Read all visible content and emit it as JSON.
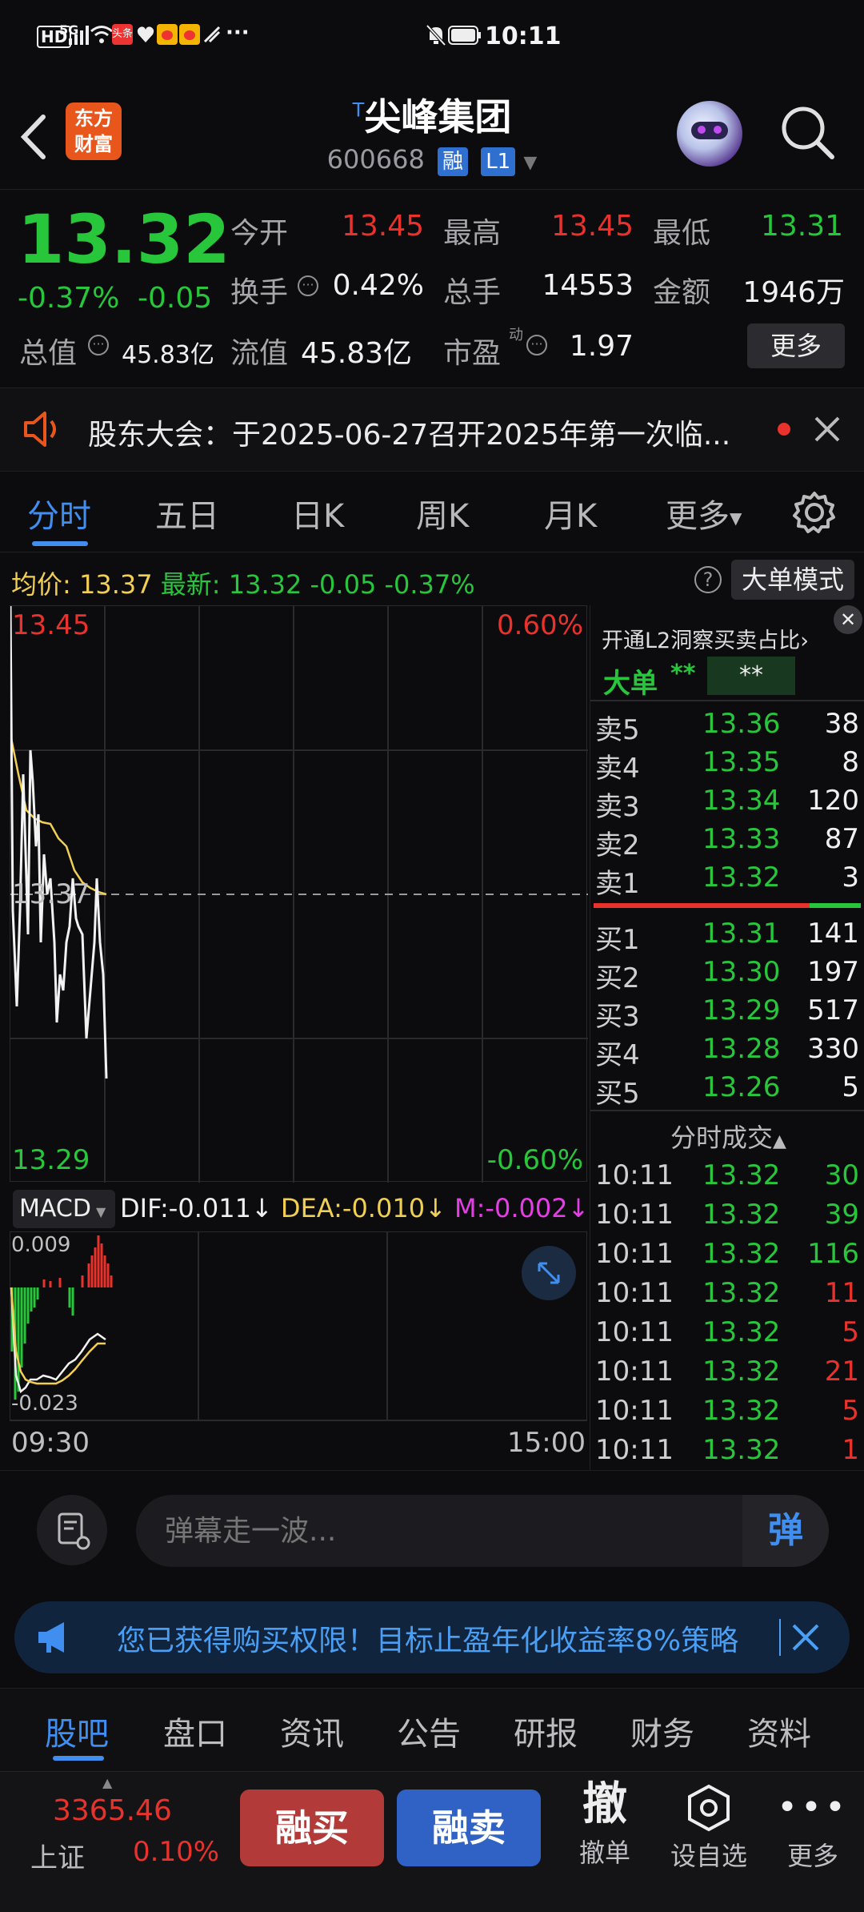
{
  "status_bar": {
    "left_icons": [
      "HD",
      "5G",
      "signal",
      "wifi",
      "头条",
      "heart",
      "weibo",
      "weibo",
      "arrow",
      "···"
    ],
    "time": "10:11"
  },
  "header": {
    "logo_line1": "东方",
    "logo_line2": "财富",
    "stock_prefix": "T",
    "stock_name": "尖峰集团",
    "stock_code": "600668",
    "tag_rong": "融",
    "tag_level": "L1"
  },
  "quote": {
    "price": "13.32",
    "change_pct": "-0.37%",
    "change": "-0.05",
    "open_label": "今开",
    "open": "13.45",
    "high_label": "最高",
    "high": "13.45",
    "low_label": "最低",
    "low": "13.31",
    "turnover_label": "换手",
    "turnover": "0.42%",
    "volume_label": "总手",
    "volume": "14553",
    "amount_label": "金额",
    "amount": "1946万",
    "mktcap_label": "总值",
    "mktcap": "45.83亿",
    "float_label": "流值",
    "float": "45.83亿",
    "pe_label": "市盈",
    "pe_sup": "动",
    "pe": "1.97",
    "more_button": "更多"
  },
  "notice": {
    "text": "股东大会：于2025-06-27召开2025年第一次临..."
  },
  "chart_tabs": [
    "分时",
    "五日",
    "日K",
    "周K",
    "月K",
    "更多"
  ],
  "avg_line": {
    "avg_label": "均价:",
    "avg_value": "13.37",
    "latest_label": "最新:",
    "latest_value": "13.32",
    "change": "-0.05",
    "change_pct": "-0.37%",
    "mode_button": "大单模式"
  },
  "chart_labels": {
    "top_price": "13.45",
    "top_pct": "0.60%",
    "mid_price": "13.37",
    "bottom_price": "13.29",
    "bottom_pct": "-0.60%",
    "start_time": "09:30",
    "end_time": "15:00"
  },
  "macd": {
    "selector": "MACD",
    "dif": "DIF:-0.011",
    "dea": "DEA:-0.010",
    "m": "M:-0.002",
    "top": "0.009",
    "bottom": "-0.023"
  },
  "order_book": {
    "l2_text": "开通L2洞察买卖占比",
    "big_order_label": "大单",
    "big_order_v1": "**",
    "big_order_v2": "**",
    "sells": [
      {
        "label": "卖5",
        "price": "13.36",
        "vol": "38"
      },
      {
        "label": "卖4",
        "price": "13.35",
        "vol": "8"
      },
      {
        "label": "卖3",
        "price": "13.34",
        "vol": "120"
      },
      {
        "label": "卖2",
        "price": "13.33",
        "vol": "87"
      },
      {
        "label": "卖1",
        "price": "13.32",
        "vol": "3"
      }
    ],
    "buys": [
      {
        "label": "买1",
        "price": "13.31",
        "vol": "141"
      },
      {
        "label": "买2",
        "price": "13.30",
        "vol": "197"
      },
      {
        "label": "买3",
        "price": "13.29",
        "vol": "517"
      },
      {
        "label": "买4",
        "price": "13.28",
        "vol": "330"
      },
      {
        "label": "买5",
        "price": "13.26",
        "vol": "5"
      }
    ],
    "ticks_title": "分时成交",
    "ticks": [
      {
        "time": "10:11",
        "price": "13.32",
        "vol": "30",
        "dir": "green"
      },
      {
        "time": "10:11",
        "price": "13.32",
        "vol": "39",
        "dir": "green"
      },
      {
        "time": "10:11",
        "price": "13.32",
        "vol": "116",
        "dir": "green"
      },
      {
        "time": "10:11",
        "price": "13.32",
        "vol": "11",
        "dir": "red"
      },
      {
        "time": "10:11",
        "price": "13.32",
        "vol": "5",
        "dir": "red"
      },
      {
        "time": "10:11",
        "price": "13.32",
        "vol": "21",
        "dir": "red"
      },
      {
        "time": "10:11",
        "price": "13.32",
        "vol": "5",
        "dir": "red"
      },
      {
        "time": "10:11",
        "price": "13.32",
        "vol": "1",
        "dir": "red"
      }
    ]
  },
  "danmu": {
    "placeholder": "弹幕走一波...",
    "send_label": "弹"
  },
  "promo": {
    "text": "您已获得购买权限！目标止盈年化收益率8%策略"
  },
  "bottom_tabs": [
    "股吧",
    "盘口",
    "资讯",
    "公告",
    "研报",
    "财务",
    "资料"
  ],
  "footer": {
    "index_value": "3365.46",
    "index_name": "上证",
    "index_pct": "0.10%",
    "buy_button": "融买",
    "sell_button": "融卖",
    "cancel_icon": "撤",
    "cancel_label": "撤单",
    "watch_label": "设自选",
    "more_label": "更多"
  },
  "colors": {
    "up": "#e8322b",
    "down": "#27c63b",
    "accent": "#3f8ef0",
    "avg_line": "#f1cf55"
  }
}
